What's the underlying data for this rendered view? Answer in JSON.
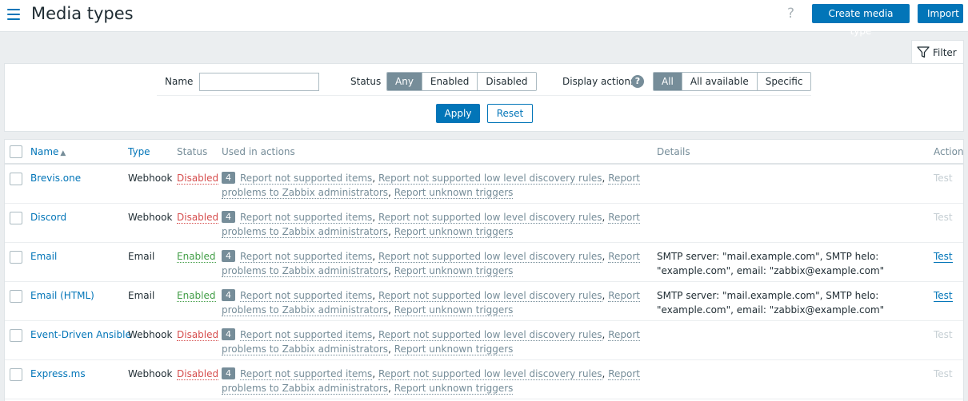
{
  "header": {
    "title": "Media types",
    "help_glyph": "?",
    "create_label": "Create media type",
    "import_label": "Import"
  },
  "filter": {
    "tab_label": "Filter",
    "name_label": "Name",
    "name_value": "",
    "status_label": "Status",
    "status_options": [
      "Any",
      "Enabled",
      "Disabled"
    ],
    "status_selected": "Any",
    "display_actions_label": "Display actions",
    "display_actions_options": [
      "All",
      "All available",
      "Specific"
    ],
    "display_actions_selected": "All",
    "apply_label": "Apply",
    "reset_label": "Reset"
  },
  "table": {
    "columns": {
      "name": "Name",
      "type": "Type",
      "status": "Status",
      "used_in_actions": "Used in actions",
      "details": "Details",
      "action": "Action"
    },
    "rows": [
      {
        "name": "Brevis.one",
        "type": "Webhook",
        "status": "Disabled",
        "count": "4",
        "actions": [
          "Report not supported items",
          "Report not supported low level discovery rules",
          "Report problems to Zabbix administrators",
          "Report unknown triggers"
        ],
        "details": "",
        "test": "Test",
        "test_enabled": false
      },
      {
        "name": "Discord",
        "type": "Webhook",
        "status": "Disabled",
        "count": "4",
        "actions": [
          "Report not supported items",
          "Report not supported low level discovery rules",
          "Report problems to Zabbix administrators",
          "Report unknown triggers"
        ],
        "details": "",
        "test": "Test",
        "test_enabled": false
      },
      {
        "name": "Email",
        "type": "Email",
        "status": "Enabled",
        "count": "4",
        "actions": [
          "Report not supported items",
          "Report not supported low level discovery rules",
          "Report problems to Zabbix administrators",
          "Report unknown triggers"
        ],
        "details": "SMTP server: \"mail.example.com\", SMTP helo: \"example.com\", email: \"zabbix@example.com\"",
        "test": "Test",
        "test_enabled": true
      },
      {
        "name": "Email (HTML)",
        "type": "Email",
        "status": "Enabled",
        "count": "4",
        "actions": [
          "Report not supported items",
          "Report not supported low level discovery rules",
          "Report problems to Zabbix administrators",
          "Report unknown triggers"
        ],
        "details": "SMTP server: \"mail.example.com\", SMTP helo: \"example.com\", email: \"zabbix@example.com\"",
        "test": "Test",
        "test_enabled": true
      },
      {
        "name": "Event-Driven Ansible",
        "type": "Webhook",
        "status": "Disabled",
        "count": "4",
        "actions": [
          "Report not supported items",
          "Report not supported low level discovery rules",
          "Report problems to Zabbix administrators",
          "Report unknown triggers"
        ],
        "details": "",
        "test": "Test",
        "test_enabled": false
      },
      {
        "name": "Express.ms",
        "type": "Webhook",
        "status": "Disabled",
        "count": "4",
        "actions": [
          "Report not supported items",
          "Report not supported low level discovery rules",
          "Report problems to Zabbix administrators",
          "Report unknown triggers"
        ],
        "details": "",
        "test": "Test",
        "test_enabled": false
      }
    ]
  }
}
